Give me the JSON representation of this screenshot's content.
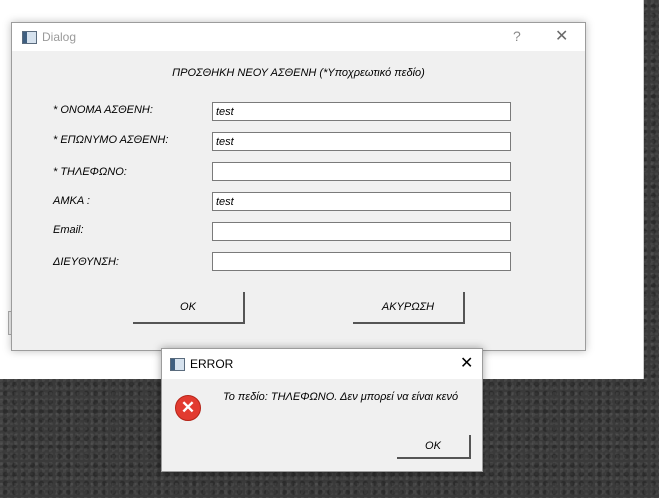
{
  "dialog": {
    "title": "Dialog",
    "help_glyph": "?",
    "close_glyph": "✕",
    "heading": "ΠΡΟΣΘΗΚΗ ΝΕΟΥ ΑΣΘΕΝΗ (*Υποχρεωτικό πεδίο)",
    "fields": [
      {
        "label": "* ΟΝΟΜΑ ΑΣΘΕΝΗ:",
        "value": "test"
      },
      {
        "label": "* ΕΠΩΝΥΜΟ ΑΣΘΕΝΗ:",
        "value": "test"
      },
      {
        "label": "* ΤΗΛΕΦΩΝΟ:",
        "value": ""
      },
      {
        "label": "ΑΜΚΑ :",
        "value": "test"
      },
      {
        "label": "Email:",
        "value": ""
      },
      {
        "label": "ΔΙΕΥΘΥΝΣΗ:",
        "value": ""
      }
    ],
    "ok_label": "OK",
    "cancel_label": "ΑΚΥΡΩΣΗ"
  },
  "error_dialog": {
    "title": "ERROR",
    "close_glyph": "✕",
    "icon_glyph": "✕",
    "message": "Το πεδίο: ΤΗΛΕΦΩΝΟ. Δεν μπορεί να είναι κενό",
    "ok_label": "OK"
  }
}
